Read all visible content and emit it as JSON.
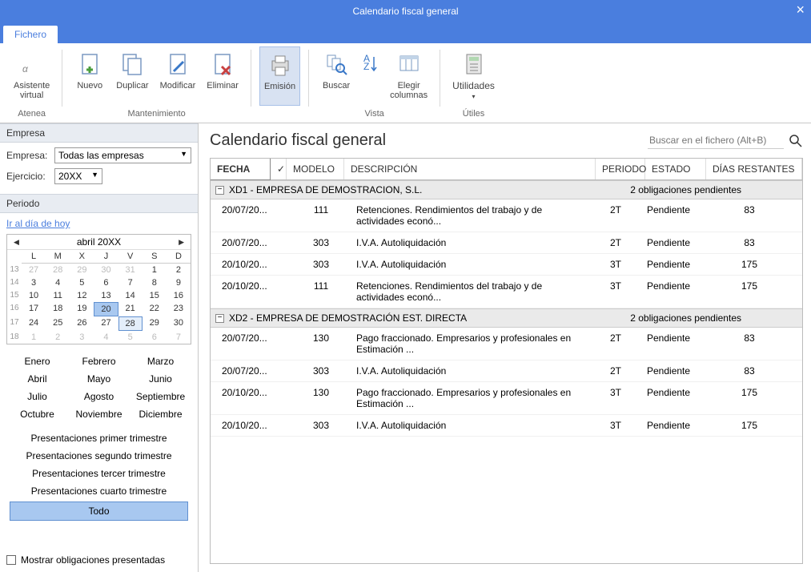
{
  "window": {
    "title": "Calendario fiscal general"
  },
  "tabs": {
    "fichero": "Fichero"
  },
  "ribbon": {
    "asistente": "Asistente\nvirtual",
    "atenea": "Atenea",
    "nuevo": "Nuevo",
    "duplicar": "Duplicar",
    "modificar": "Modificar",
    "eliminar": "Eliminar",
    "mantenimiento": "Mantenimiento",
    "emision": "Emisión",
    "buscar": "Buscar",
    "ordenar": "",
    "elegir": "Elegir\ncolumnas",
    "vista": "Vista",
    "utilidades": "Utilidades",
    "utiles": "Útiles"
  },
  "sidebar": {
    "empresa_header": "Empresa",
    "empresa_label": "Empresa:",
    "empresa_value": "Todas las empresas",
    "ejercicio_label": "Ejercicio:",
    "ejercicio_value": "20XX",
    "periodo_header": "Periodo",
    "ir_hoy": "Ir al día de hoy",
    "cal_month": "abril  20XX",
    "dow": [
      "L",
      "M",
      "X",
      "J",
      "V",
      "S",
      "D"
    ],
    "weeks": [
      "13",
      "14",
      "15",
      "16",
      "17",
      "18"
    ],
    "days": [
      [
        "27",
        "28",
        "29",
        "30",
        "31",
        "1",
        "2"
      ],
      [
        "3",
        "4",
        "5",
        "6",
        "7",
        "8",
        "9"
      ],
      [
        "10",
        "11",
        "12",
        "13",
        "14",
        "15",
        "16"
      ],
      [
        "17",
        "18",
        "19",
        "20",
        "21",
        "22",
        "23"
      ],
      [
        "24",
        "25",
        "26",
        "27",
        "28",
        "29",
        "30"
      ],
      [
        "1",
        "2",
        "3",
        "4",
        "5",
        "6",
        "7"
      ]
    ],
    "months": [
      "Enero",
      "Febrero",
      "Marzo",
      "Abril",
      "Mayo",
      "Junio",
      "Julio",
      "Agosto",
      "Septiembre",
      "Octubre",
      "Noviembre",
      "Diciembre"
    ],
    "quick": [
      "Presentaciones primer trimestre",
      "Presentaciones segundo trimestre",
      "Presentaciones tercer trimestre",
      "Presentaciones cuarto trimestre"
    ],
    "todo": "Todo",
    "mostrar_chk": "Mostrar obligaciones presentadas"
  },
  "content": {
    "title": "Calendario fiscal general",
    "search_placeholder": "Buscar en el fichero (Alt+B)",
    "columns": {
      "fecha": "FECHA",
      "modelo": "MODELO",
      "descripcion": "DESCRIPCIÓN",
      "periodo": "PERIODO",
      "estado": "ESTADO",
      "dias": "DÍAS RESTANTES"
    },
    "groups": [
      {
        "name": "XD1 - EMPRESA DE DEMOSTRACION, S.L.",
        "summary": "2 obligaciones pendientes",
        "rows": [
          {
            "fecha": "20/07/20...",
            "modelo": "111",
            "desc": "Retenciones. Rendimientos del trabajo y de actividades econó...",
            "periodo": "2T",
            "estado": "Pendiente",
            "dias": "83"
          },
          {
            "fecha": "20/07/20...",
            "modelo": "303",
            "desc": "I.V.A. Autoliquidación",
            "periodo": "2T",
            "estado": "Pendiente",
            "dias": "83"
          },
          {
            "fecha": "20/10/20...",
            "modelo": "303",
            "desc": "I.V.A. Autoliquidación",
            "periodo": "3T",
            "estado": "Pendiente",
            "dias": "175"
          },
          {
            "fecha": "20/10/20...",
            "modelo": "111",
            "desc": "Retenciones. Rendimientos del trabajo y de actividades econó...",
            "periodo": "3T",
            "estado": "Pendiente",
            "dias": "175"
          }
        ]
      },
      {
        "name": "XD2 - EMPRESA DE DEMOSTRACIÓN EST. DIRECTA",
        "summary": "2 obligaciones pendientes",
        "rows": [
          {
            "fecha": "20/07/20...",
            "modelo": "130",
            "desc": "Pago fraccionado. Empresarios y profesionales en Estimación ...",
            "periodo": "2T",
            "estado": "Pendiente",
            "dias": "83"
          },
          {
            "fecha": "20/07/20...",
            "modelo": "303",
            "desc": "I.V.A. Autoliquidación",
            "periodo": "2T",
            "estado": "Pendiente",
            "dias": "83"
          },
          {
            "fecha": "20/10/20...",
            "modelo": "130",
            "desc": "Pago fraccionado. Empresarios y profesionales en Estimación ...",
            "periodo": "3T",
            "estado": "Pendiente",
            "dias": "175"
          },
          {
            "fecha": "20/10/20...",
            "modelo": "303",
            "desc": "I.V.A. Autoliquidación",
            "periodo": "3T",
            "estado": "Pendiente",
            "dias": "175"
          }
        ]
      }
    ]
  }
}
